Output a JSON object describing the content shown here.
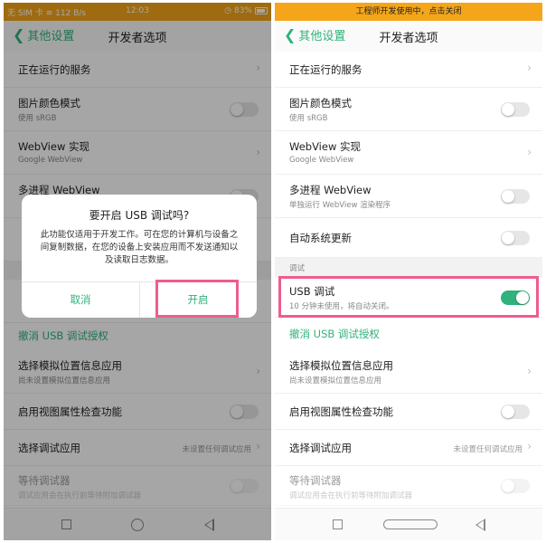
{
  "left": {
    "status": {
      "carrier": "无 SIM 卡",
      "speed": "112 B/s",
      "time": "12:03",
      "battery": "83%"
    },
    "nav": {
      "back_label": "其他设置",
      "title": "开发者选项"
    },
    "rows": {
      "running_services": "正在运行的服务",
      "image_color_mode": "图片颜色模式",
      "image_color_mode_sub": "使用 sRGB",
      "webview": "WebView 实现",
      "webview_sub": "Google WebView",
      "multiprocess": "多进程 WebView",
      "revoke_usb": "撤消 USB 调试授权",
      "mock_location": "选择模拟位置信息应用",
      "mock_location_sub": "尚未设置模拟位置信息应用",
      "view_attr": "启用视图属性检查功能",
      "debug_app": "选择调试应用",
      "debug_app_value": "未设置任何调试应用",
      "wait_debugger": "等待调试器",
      "wait_debugger_sub": "调试应用会在执行前等待附加调试器"
    },
    "dialog": {
      "title": "要开启 USB 调试吗?",
      "message": "此功能仅适用于开发工作。可在您的计算机与设备之间复制数据，在您的设备上安装应用而不发送通知以及读取日志数据。",
      "cancel": "取消",
      "ok": "开启"
    }
  },
  "right": {
    "banner": "工程师开发使用中，点击关闭",
    "nav": {
      "back_label": "其他设置",
      "title": "开发者选项"
    },
    "rows": {
      "running_services": "正在运行的服务",
      "image_color_mode": "图片颜色模式",
      "image_color_mode_sub": "使用 sRGB",
      "webview": "WebView 实现",
      "webview_sub": "Google WebView",
      "multiprocess": "多进程 WebView",
      "multiprocess_sub": "单独运行 WebView 渲染程序",
      "auto_update": "自动系统更新",
      "section_debug": "调试",
      "usb_debug": "USB 调试",
      "usb_debug_sub": "10 分钟未使用，将自动关闭。",
      "revoke_usb": "撤消 USB 调试授权",
      "mock_location": "选择模拟位置信息应用",
      "mock_location_sub": "尚未设置模拟位置信息应用",
      "view_attr": "启用视图属性检查功能",
      "debug_app": "选择调试应用",
      "debug_app_value": "未设置任何调试应用",
      "wait_debugger": "等待调试器",
      "wait_debugger_sub": "调试应用会在执行前等待附加调试器"
    },
    "toggles": {
      "image_color_mode": false,
      "multiprocess": false,
      "auto_update": false,
      "usb_debug": true,
      "view_attr": false,
      "wait_debugger": false
    }
  },
  "colors": {
    "accent": "#2fb27c",
    "status_bar": "#f5a51a",
    "highlight": "#ee5d8e"
  },
  "icons": [
    "back-chevron-icon",
    "chevron-right-icon",
    "wifi-icon",
    "alarm-icon",
    "battery-icon",
    "recents-icon",
    "home-icon",
    "back-icon"
  ]
}
